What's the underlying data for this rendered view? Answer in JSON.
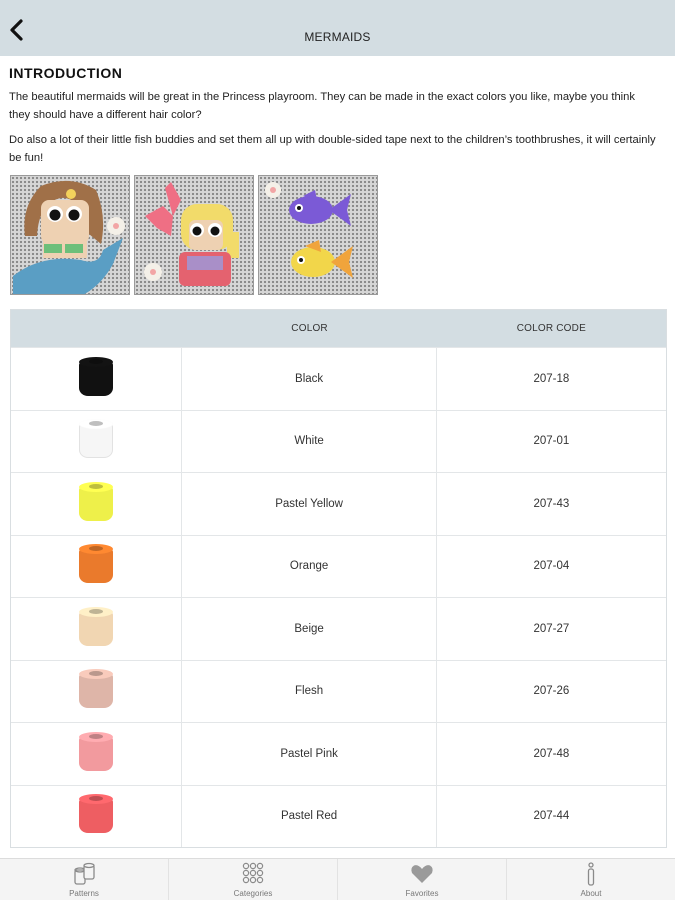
{
  "header": {
    "title": "MERMAIDS",
    "back_icon": "chevron-left-icon"
  },
  "intro": {
    "heading": "INTRODUCTION",
    "paragraphs": [
      "The beautiful mermaids will be great in the Princess playroom. They can be made in the exact colors you like, maybe you think they should have a different hair color?",
      "Do also a lot of their little fish buddies and set them all up with double-sided tape next to the children’s toothbrushes, it will certainly be fun!"
    ]
  },
  "images": [
    {
      "subject": "mermaid with brown hair and blue tail"
    },
    {
      "subject": "mermaid with blonde hair and pink tail"
    },
    {
      "subject": "purple fish and yellow fish"
    }
  ],
  "table": {
    "headers": [
      "",
      "COLOR",
      "COLOR CODE"
    ],
    "rows": [
      {
        "color": "Black",
        "code": "207-18",
        "swatch": "#111111"
      },
      {
        "color": "White",
        "code": "207-01",
        "swatch": "#f6f6f6"
      },
      {
        "color": "Pastel Yellow",
        "code": "207-43",
        "swatch": "#eef04a"
      },
      {
        "color": "Orange",
        "code": "207-04",
        "swatch": "#ea7a2c"
      },
      {
        "color": "Beige",
        "code": "207-27",
        "swatch": "#f1d6b2"
      },
      {
        "color": "Flesh",
        "code": "207-26",
        "swatch": "#deb5a8"
      },
      {
        "color": "Pastel Pink",
        "code": "207-48",
        "swatch": "#f29a9e"
      },
      {
        "color": "Pastel Red",
        "code": "207-44",
        "swatch": "#ee5e62"
      }
    ]
  },
  "tabbar": {
    "tabs": [
      {
        "label": "Patterns",
        "icon": "spools-icon"
      },
      {
        "label": "Categories",
        "icon": "bead-grid-icon"
      },
      {
        "label": "Favorites",
        "icon": "heart-icon"
      },
      {
        "label": "About",
        "icon": "info-icon"
      }
    ]
  },
  "colors": {
    "header_bg": "#d3dde2",
    "tab_inactive": "#777777"
  }
}
